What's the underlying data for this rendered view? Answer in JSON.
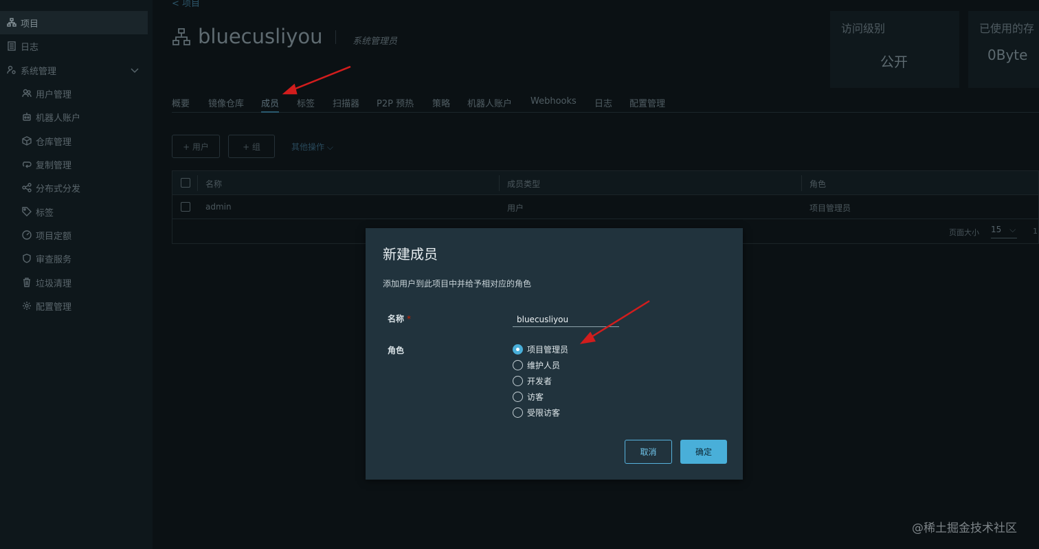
{
  "sidebar": {
    "items": [
      {
        "label": "项目",
        "icon": "project-icon"
      },
      {
        "label": "日志",
        "icon": "log-icon"
      },
      {
        "label": "系统管理",
        "icon": "admin-icon"
      }
    ],
    "sub_items": [
      {
        "label": "用户管理",
        "icon": "users-icon"
      },
      {
        "label": "机器人账户",
        "icon": "robot-icon"
      },
      {
        "label": "仓库管理",
        "icon": "registry-icon"
      },
      {
        "label": "复制管理",
        "icon": "replication-icon"
      },
      {
        "label": "分布式分发",
        "icon": "share-icon"
      },
      {
        "label": "标签",
        "icon": "tag-icon"
      },
      {
        "label": "项目定额",
        "icon": "quota-icon"
      },
      {
        "label": "审查服务",
        "icon": "shield-icon"
      },
      {
        "label": "垃圾清理",
        "icon": "trash-icon"
      },
      {
        "label": "配置管理",
        "icon": "gear-icon"
      }
    ]
  },
  "header": {
    "back": "< 项目",
    "title": "bluecusliyou",
    "role": "系统管理员"
  },
  "cards": {
    "access_label": "访问级别",
    "access_value": "公开",
    "storage_label": "已使用的存",
    "storage_value": "0Byte"
  },
  "tabs": [
    "概要",
    "镜像仓库",
    "成员",
    "标签",
    "扫描器",
    "P2P 预热",
    "策略",
    "机器人账户",
    "Webhooks",
    "日志",
    "配置管理"
  ],
  "toolbar": {
    "add_user": "+ 用户",
    "add_group": "+ 组",
    "more": "其他操作"
  },
  "table": {
    "headers": [
      "名称",
      "成员类型",
      "角色"
    ],
    "rows": [
      [
        "admin",
        "用户",
        "项目管理员"
      ]
    ],
    "page_size_label": "页面大小",
    "page_size": "15",
    "page_info": "1"
  },
  "modal": {
    "title": "新建成员",
    "description": "添加用户到此项目中并给予相对应的角色",
    "name_label": "名称",
    "required_mark": "*",
    "name_value": "bluecusliyou",
    "role_label": "角色",
    "roles": [
      "项目管理员",
      "维护人员",
      "开发者",
      "访客",
      "受限访客"
    ],
    "selected_role": "项目管理员",
    "cancel": "取消",
    "confirm": "确定"
  },
  "watermark": "@稀土掘金技术社区",
  "colors": {
    "accent": "#49afd9",
    "modal_bg": "#21333d",
    "page_bg": "#0b1114",
    "annotation_arrow": "#d21d1d"
  }
}
